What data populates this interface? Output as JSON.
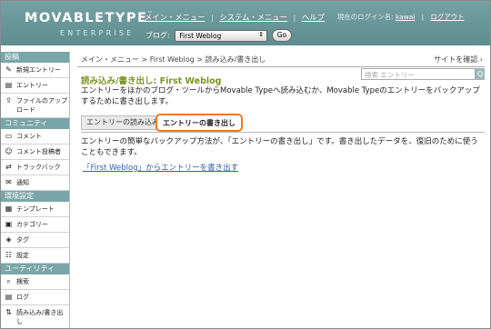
{
  "header": {
    "logo_main": "MOVABLETYPE",
    "logo_tm": "™",
    "logo_sub": "ENTERPRISE",
    "nav": [
      "メイン・メニュー",
      "システム・メニュー",
      "ヘルプ"
    ],
    "separator": "|",
    "user_label": "現在のログイン名: ",
    "username": "kawai",
    "logout": "ログアウト",
    "blog_label": "ブログ:",
    "blog_selected": "First Weblog",
    "go_label": "Go"
  },
  "sidebar": {
    "sections": [
      {
        "title": "投稿",
        "items": [
          {
            "icon": "new-entry-icon",
            "label": "新規エントリー"
          },
          {
            "icon": "entries-icon",
            "label": "エントリー"
          },
          {
            "icon": "upload-icon",
            "label": "ファイルのアップロード"
          }
        ]
      },
      {
        "title": "コミュニティ",
        "items": [
          {
            "icon": "comment-icon",
            "label": "コメント"
          },
          {
            "icon": "commenter-icon",
            "label": "コメント投稿者"
          },
          {
            "icon": "trackback-icon",
            "label": "トラックバック"
          },
          {
            "icon": "notification-icon",
            "label": "通知"
          }
        ]
      },
      {
        "title": "環境設定",
        "items": [
          {
            "icon": "template-icon",
            "label": "テンプレート"
          },
          {
            "icon": "category-icon",
            "label": "カテゴリー"
          },
          {
            "icon": "tag-icon",
            "label": "タグ"
          },
          {
            "icon": "settings-icon",
            "label": "設定"
          }
        ]
      },
      {
        "title": "ユーティリティ",
        "items": [
          {
            "icon": "search-icon",
            "label": "検索"
          },
          {
            "icon": "log-icon",
            "label": "ログ"
          },
          {
            "icon": "import-export-icon",
            "label": "読み込み/書き出し"
          }
        ]
      }
    ]
  },
  "main": {
    "breadcrumb": "メイン・メニュー > First Weblog > 読み込み/書き出し",
    "view_site": "サイトを確認",
    "title": "読み込み/書き出し: First Weblog",
    "search_placeholder": "検索 エントリー",
    "search_button": "Q",
    "intro": "エントリーをほかのブログ・ツールからMovable Typeへ読み込むか、Movable Typeのエントリーをバックアップするために書き出します。",
    "tabs": {
      "import": "エントリーの読み込み",
      "export": "エントリーの書き出し"
    },
    "description": "エントリーの簡単なバックアップ方法が、「エントリーの書き出し」です。書き出したデータを、復旧のために使うこともできます。",
    "export_link": "「First Weblog」からエントリーを書き出す"
  },
  "colors": {
    "header_bg": "#6a9699",
    "section_bg": "#7aa6a8",
    "title_green": "#7a9420",
    "highlight_orange": "#ee7a1c",
    "link_blue": "#2f5fa8"
  }
}
